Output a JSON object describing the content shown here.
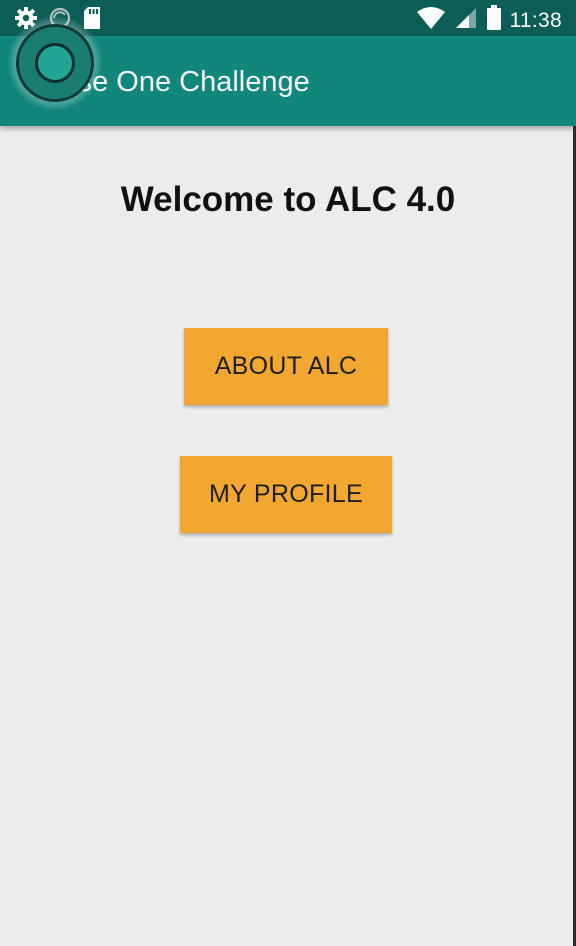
{
  "status_bar": {
    "time": "11:38",
    "left_icons": [
      "gear-icon",
      "sync-icon",
      "sd-card-icon"
    ],
    "right_icons": [
      "wifi-icon",
      "cell-signal-icon",
      "battery-icon"
    ]
  },
  "app_bar": {
    "title": "Phase One Challenge",
    "color": "#11867a"
  },
  "main": {
    "welcome": "Welcome to ALC 4.0",
    "buttons": {
      "about": "ABOUT ALC",
      "profile": "MY PROFILE"
    },
    "accent": "#f2a830"
  }
}
